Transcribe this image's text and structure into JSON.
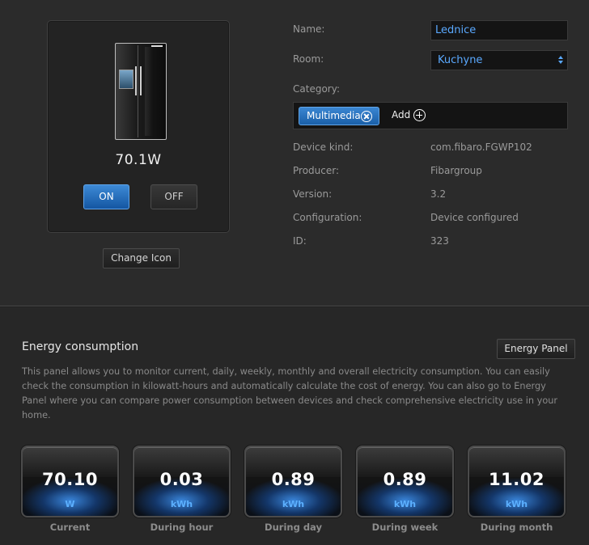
{
  "device": {
    "power": "70.1W",
    "on_label": "ON",
    "off_label": "OFF",
    "change_icon_label": "Change Icon"
  },
  "properties": {
    "name_label": "Name:",
    "name_value": "Lednice",
    "room_label": "Room:",
    "room_value": "Kuchyne",
    "category_label": "Category:",
    "category_chip": "Multimedia",
    "add_label": "Add",
    "kind_label": "Device kind:",
    "kind_value": "com.fibaro.FGWP102",
    "producer_label": "Producer:",
    "producer_value": "Fibargroup",
    "version_label": "Version:",
    "version_value": "3.2",
    "config_label": "Configuration:",
    "config_value": "Device configured",
    "id_label": "ID:",
    "id_value": "323"
  },
  "energy": {
    "title": "Energy consumption",
    "panel_button": "Energy Panel",
    "description": "This panel allows you to monitor current, daily, weekly, monthly and overall electricity consumption. You can easily check the consumption in kilowatt-hours and automatically calculate the cost of energy. You can also go to Energy Panel where you can compare power consumption between devices and check comprehensive electricity use in your home.",
    "tiles": [
      {
        "value": "70.10",
        "unit": "W",
        "caption": "Current"
      },
      {
        "value": "0.03",
        "unit": "kWh",
        "caption": "During hour"
      },
      {
        "value": "0.89",
        "unit": "kWh",
        "caption": "During day"
      },
      {
        "value": "0.89",
        "unit": "kWh",
        "caption": "During week"
      },
      {
        "value": "11.02",
        "unit": "kWh",
        "caption": "During month"
      }
    ]
  },
  "colors": {
    "accent": "#1a6fc4",
    "value_text": "#5aa9ff"
  }
}
